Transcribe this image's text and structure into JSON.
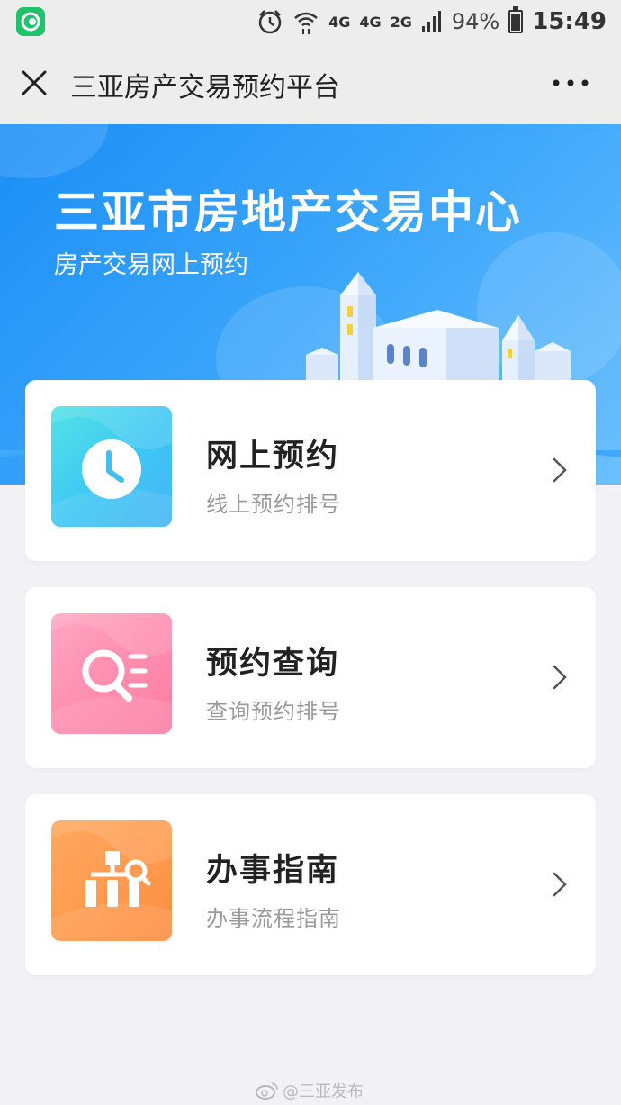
{
  "status_bar": {
    "network_labels": [
      "4G",
      "4G",
      "2G"
    ],
    "battery_percent": "94%",
    "time": "15:49"
  },
  "nav": {
    "title": "三亚房产交易预约平台"
  },
  "banner": {
    "title": "三亚市房地产交易中心",
    "subtitle": "房产交易网上预约"
  },
  "cards": [
    {
      "title": "网上预约",
      "description": "线上预约排号",
      "icon": "clock-icon"
    },
    {
      "title": "预约查询",
      "description": "查询预约排号",
      "icon": "search-list-icon"
    },
    {
      "title": "办事指南",
      "description": "办事流程指南",
      "icon": "flowchart-search-icon"
    }
  ],
  "watermark": {
    "text": "@三亚发布"
  },
  "colors": {
    "accent": "#1b8ff6",
    "app_icon": "#1fc46a",
    "tile_blue": "#3fc6f4",
    "tile_pink": "#ff8cae",
    "tile_orange": "#ff9a4e"
  }
}
